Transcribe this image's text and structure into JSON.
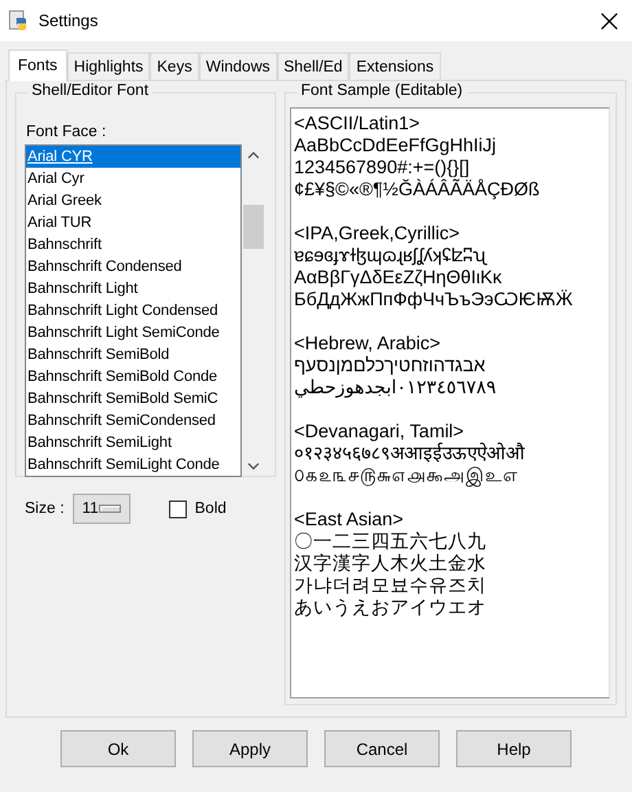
{
  "window": {
    "title": "Settings"
  },
  "tabs": [
    {
      "label": "Fonts",
      "selected": true
    },
    {
      "label": "Highlights",
      "selected": false
    },
    {
      "label": "Keys",
      "selected": false
    },
    {
      "label": "Windows",
      "selected": false
    },
    {
      "label": "Shell/Ed",
      "selected": false
    },
    {
      "label": "Extensions",
      "selected": false
    }
  ],
  "font_group": {
    "title": "Shell/Editor Font",
    "face_label": "Font Face :",
    "fonts": [
      {
        "name": "Arial CYR",
        "selected": true
      },
      {
        "name": "Arial Cyr",
        "selected": false
      },
      {
        "name": "Arial Greek",
        "selected": false
      },
      {
        "name": "Arial TUR",
        "selected": false
      },
      {
        "name": "Bahnschrift",
        "selected": false
      },
      {
        "name": "Bahnschrift Condensed",
        "selected": false
      },
      {
        "name": "Bahnschrift Light",
        "selected": false
      },
      {
        "name": "Bahnschrift Light Condensed",
        "selected": false
      },
      {
        "name": "Bahnschrift Light SemiConde",
        "selected": false
      },
      {
        "name": "Bahnschrift SemiBold",
        "selected": false
      },
      {
        "name": "Bahnschrift SemiBold Conde",
        "selected": false
      },
      {
        "name": "Bahnschrift SemiBold SemiC",
        "selected": false
      },
      {
        "name": "Bahnschrift SemiCondensed",
        "selected": false
      },
      {
        "name": "Bahnschrift SemiLight",
        "selected": false
      },
      {
        "name": "Bahnschrift SemiLight Conde",
        "selected": false
      }
    ],
    "size_label": "Size :",
    "size": "11",
    "bold": {
      "label": "Bold",
      "checked": false
    }
  },
  "sample_group": {
    "title": "Font Sample (Editable)",
    "sections": [
      {
        "lines": [
          "<ASCII/Latin1>",
          "AaBbCcDdEeFfGgHhIiJj",
          "1234567890#:+=(){}[]",
          "¢£¥§©«®¶½ĞÀÁÂÃÄÅÇĐØß"
        ]
      },
      {
        "lines": [
          "<IPA,Greek,Cyrillic>",
          "ɐɕɘɞɟɤɫɮɰɷɻʁʃʆʎʞʢʫʭʯ",
          "ΑαΒβΓγΔδΕεΖζΗηΘθΙιΚκ",
          "БбДдЖжПпФфЧчЪъЭэѠѤѬӜ"
        ]
      },
      {
        "lines": [
          "<Hebrew, Arabic>",
          "אבגדהוזחטיךכלםמןנסעף",
          "٠١٢٣٤٥٦٧٨٩ابجدهوزحطي"
        ]
      },
      {
        "lines": [
          "<Devanagari, Tamil>",
          "०१२३४५६७८९अआइईउऊएऐओऔ",
          "௦௧௨௩௪௫௬௭௮௯அஇஉஎ"
        ]
      },
      {
        "lines": [
          "<East Asian>",
          "〇一二三四五六七八九",
          "汉字漢字人木火土金水",
          "가냐더려모뵤수유즈치",
          "あいうえおアイウエオ"
        ]
      }
    ]
  },
  "buttons": [
    "Ok",
    "Apply",
    "Cancel",
    "Help"
  ]
}
